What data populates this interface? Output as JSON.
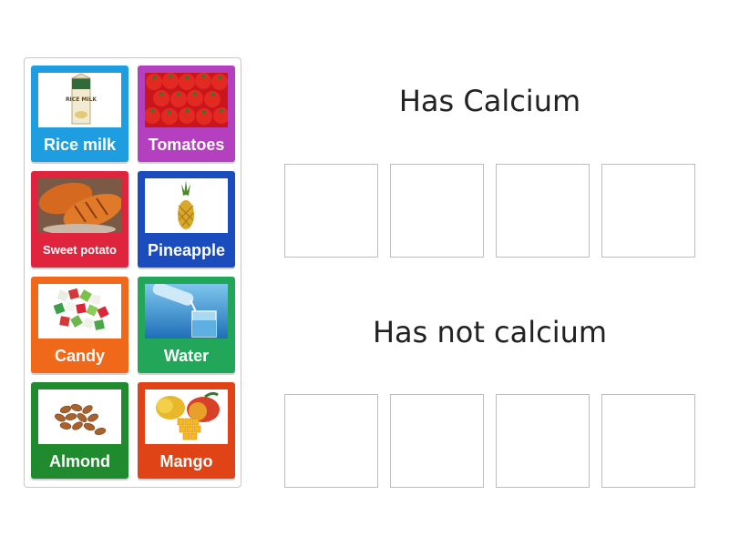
{
  "cards": [
    {
      "label": "Rice milk",
      "color": "#1e9ee0",
      "image": "rice-milk-carton"
    },
    {
      "label": "Tomatoes",
      "color": "#b43fbf",
      "image": "tomatoes"
    },
    {
      "label": "Sweet potato",
      "color": "#e0243e",
      "image": "sweet-potato"
    },
    {
      "label": "Pineapple",
      "color": "#1a4cbd",
      "image": "pineapple"
    },
    {
      "label": "Candy",
      "color": "#f0681a",
      "image": "candy"
    },
    {
      "label": "Water",
      "color": "#22a65a",
      "image": "water-glass"
    },
    {
      "label": "Almond",
      "color": "#1f8a2e",
      "image": "almonds"
    },
    {
      "label": "Mango",
      "color": "#e04416",
      "image": "mango"
    }
  ],
  "groups": [
    {
      "title": "Has Calcium",
      "slots": 4
    },
    {
      "title": "Has not calcium",
      "slots": 4
    }
  ],
  "milk_carton_text": "RICE MILK"
}
